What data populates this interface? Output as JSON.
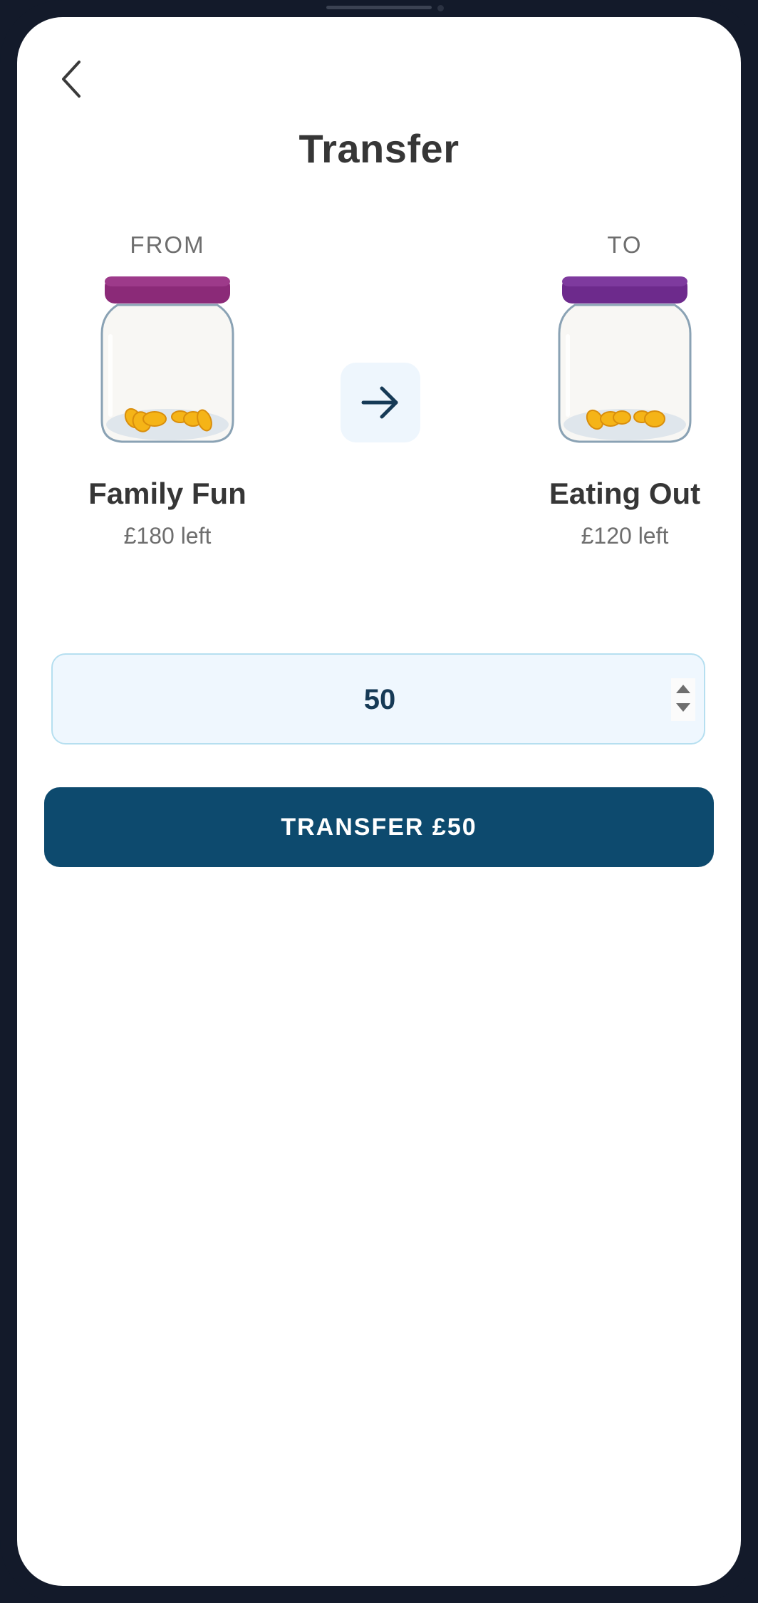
{
  "header": {
    "title": "Transfer"
  },
  "from": {
    "label": "FROM",
    "name": "Family Fun",
    "remaining": "£180 left",
    "lid_color": "#8b2a78"
  },
  "to": {
    "label": "TO",
    "name": "Eating Out",
    "remaining": "£120 left",
    "lid_color": "#6d2a8c"
  },
  "amount": {
    "value": "50"
  },
  "action": {
    "label": "TRANSFER £50"
  },
  "colors": {
    "primary": "#0d4a6e",
    "field_bg": "#eff7fe",
    "field_border": "#b6dff0",
    "coins": "#f5b417"
  },
  "icons": {
    "back": "chevron-left-icon",
    "swap": "arrow-right-icon"
  }
}
